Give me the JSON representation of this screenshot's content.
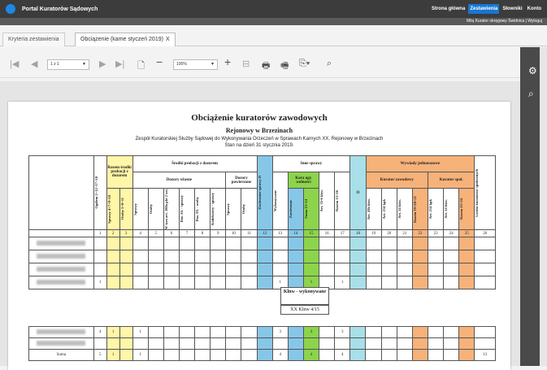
{
  "app": {
    "title": "Portal Kuratorów Sądowych"
  },
  "nav": [
    "Strona główna",
    "Zestawienia",
    "Słowniki",
    "Konto"
  ],
  "user": "Milą Kurator okręgowy Świdnica | Wyloguj",
  "tabs": [
    {
      "label": "Kryteria zestawienia"
    },
    {
      "label": "Obciążenie (kame styczeń 2019)",
      "close": "X"
    }
  ],
  "toolbar": {
    "page": "1 z 1",
    "zoom": "100%"
  },
  "document": {
    "title": "Obciążenie kuratorów zawodowych",
    "subtitle": "Rejonowy w Brzezinach",
    "line1": "Zespół Kuratorskiej Służby Sądowej do Wykonywania Orzeczeń w Sprawach Karnych XX, Rejonowy w Brzezinach",
    "line2": "Stan na dzień 31 stycznia 2019."
  },
  "table": {
    "h": {
      "c1": "Ogółem 2+12+17+18",
      "razem": "Razem środki probacji z dozorem",
      "c2": "Sprawy 4+7+9+10",
      "c3": "Osoby 5+8+11",
      "srodki": "Środki probacji z dozorem",
      "dozory_wlasne": "Dozory własne",
      "dozory_powierzone": "Dozory powierzone",
      "c4": "Sprawy",
      "c5": "Osoby",
      "c6": "W tym art. 180a pkt 2 ust.",
      "c7": "Doz. EŁ - sprawy",
      "c8": "Doz. EŁ - osoby",
      "c9": "Kodeksowy - sprawy",
      "c10": "Sprawy",
      "c11": "Osoby",
      "c12": "Zawieszone sprawy D",
      "inne": "Inne sprawy",
      "kara": "Kara ogr. wolności",
      "c13": "Wykonywane",
      "c14": "Zawieszone",
      "c15": "Suma 13+14",
      "c16": "Art. 35-6 kkw.",
      "c17": "Razem 15+16",
      "c18": "O",
      "wywiady": "Wywiady jednorazowe",
      "kz": "Kurator zawodowy",
      "ks": "Kurator spol.",
      "c19": "Art. 43h kkw.",
      "c20": "Art. 214 kpk",
      "c21": "Art. 14 kkw.",
      "c22": "Razem 19+20+21",
      "c23": "Art. 214 kpk",
      "c24": "Art. 14 kkw.",
      "c25": "Razem 23+24",
      "c26": "Liczba kuratorów społecznych"
    },
    "nums": [
      "1",
      "2",
      "3",
      "4",
      "5",
      "6",
      "7",
      "8",
      "9",
      "10",
      "11",
      "12",
      "13",
      "14",
      "15",
      "16",
      "17",
      "18",
      "19",
      "20",
      "21",
      "22",
      "23",
      "24",
      "25",
      "26"
    ],
    "rows": [
      {
        "c1": "",
        "c13": "",
        "c15": "",
        "c17": ""
      },
      {
        "c1": "",
        "c13": "",
        "c15": "",
        "c17": ""
      },
      {
        "c1": "",
        "c13": "",
        "c15": "",
        "c17": ""
      },
      {
        "c1": "1",
        "c13": "1",
        "c15": "1",
        "c17": "1"
      }
    ],
    "rows2": [
      {
        "c1": "4",
        "c2": "1",
        "c4": "1",
        "c13": "3",
        "c15": "3",
        "c17": "3"
      },
      {
        "c1": "",
        "c2": "",
        "c4": "",
        "c13": "",
        "c15": "",
        "c17": ""
      },
      {
        "c1": "5",
        "c2": "1",
        "c4": "1",
        "c13": "4",
        "c15": "4",
        "c17": "4",
        "c26": "13",
        "label": "Suma"
      }
    ]
  },
  "klnw": {
    "title": "Klnw - wykonywane",
    "value": "XX Klnw 4/15"
  },
  "colors": {
    "accent": "#1976d2",
    "yellow": "#fff6a8",
    "blue": "#86c7e8",
    "green": "#8cd44b",
    "orange": "#f7b27a"
  }
}
